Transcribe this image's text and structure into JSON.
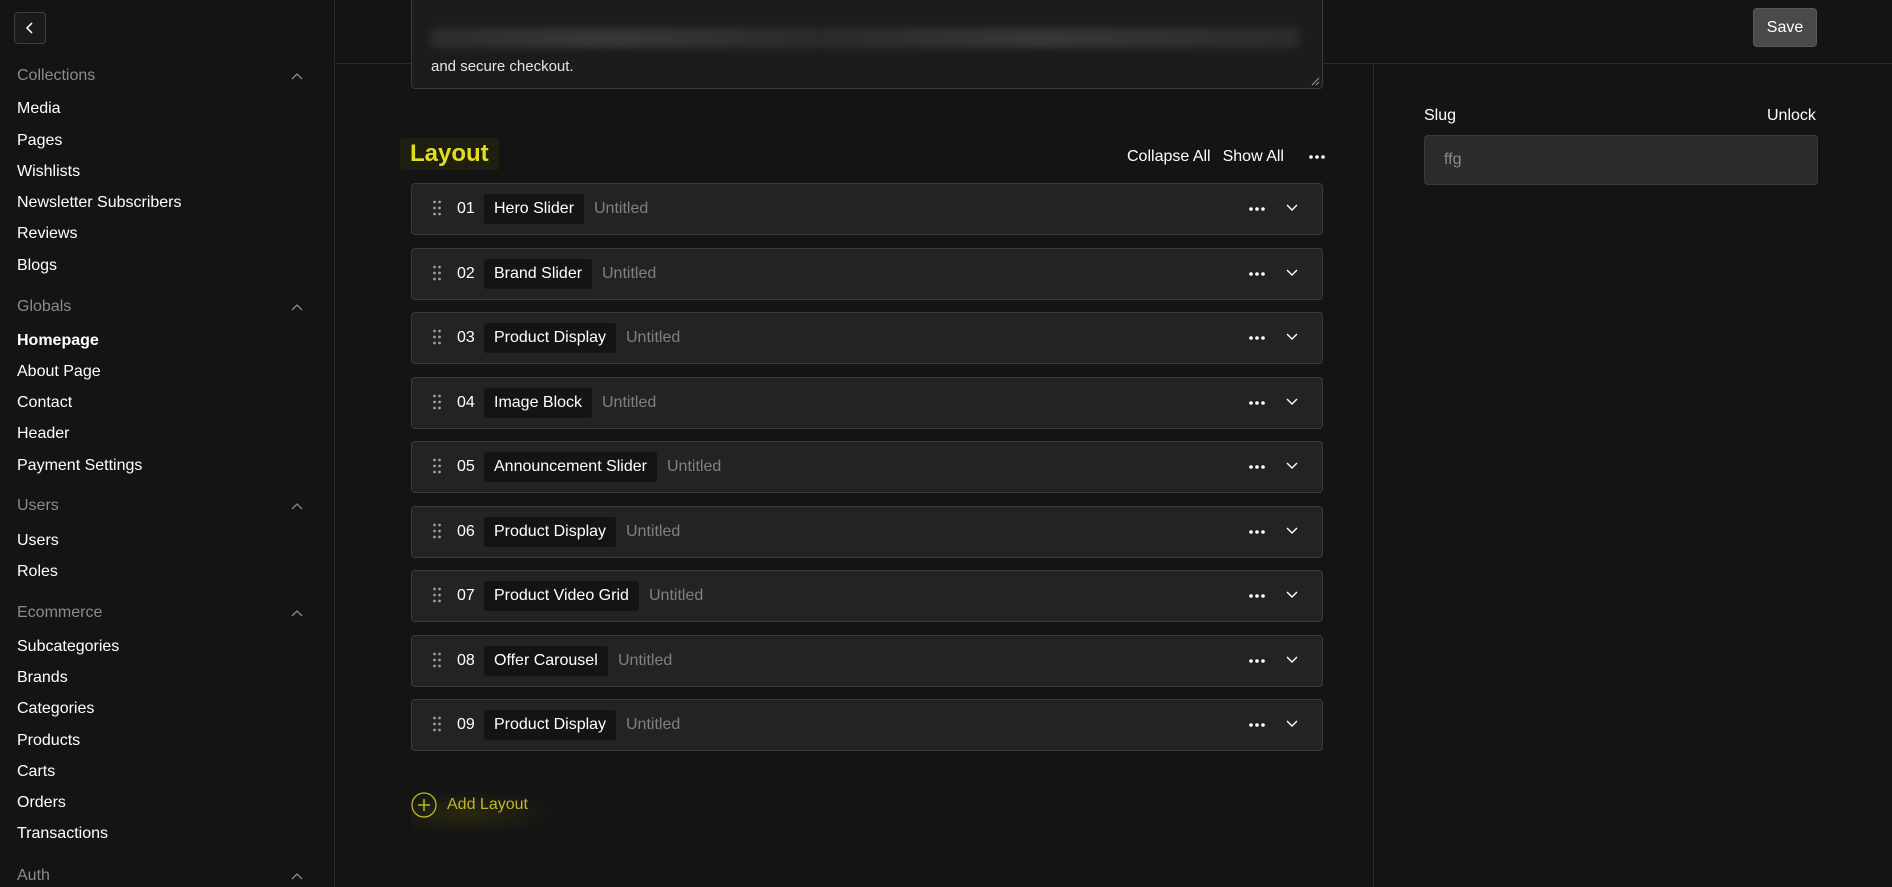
{
  "sidebar": {
    "groups": [
      {
        "title": "Collections",
        "items": [
          "Media",
          "Pages",
          "Wishlists",
          "Newsletter Subscribers",
          "Reviews",
          "Blogs"
        ]
      },
      {
        "title": "Globals",
        "items": [
          "Homepage",
          "About Page",
          "Contact",
          "Header",
          "Payment Settings"
        ],
        "active": "Homepage"
      },
      {
        "title": "Users",
        "items": [
          "Users",
          "Roles"
        ]
      },
      {
        "title": "Ecommerce",
        "items": [
          "Subcategories",
          "Brands",
          "Categories",
          "Products",
          "Carts",
          "Orders",
          "Transactions"
        ]
      },
      {
        "title": "Auth",
        "items": []
      }
    ]
  },
  "toolbar": {
    "save_label": "Save"
  },
  "description_field": {
    "visible_text": "and secure checkout."
  },
  "layout_section": {
    "title": "Layout",
    "collapse_all_label": "Collapse All",
    "show_all_label": "Show All",
    "blocks": [
      {
        "num": "01",
        "type": "Hero Slider",
        "title": "Untitled"
      },
      {
        "num": "02",
        "type": "Brand Slider",
        "title": "Untitled"
      },
      {
        "num": "03",
        "type": "Product Display",
        "title": "Untitled"
      },
      {
        "num": "04",
        "type": "Image Block",
        "title": "Untitled"
      },
      {
        "num": "05",
        "type": "Announcement Slider",
        "title": "Untitled"
      },
      {
        "num": "06",
        "type": "Product Display",
        "title": "Untitled"
      },
      {
        "num": "07",
        "type": "Product Video Grid",
        "title": "Untitled"
      },
      {
        "num": "08",
        "type": "Offer Carousel",
        "title": "Untitled"
      },
      {
        "num": "09",
        "type": "Product Display",
        "title": "Untitled"
      }
    ],
    "add_layout_label": "Add Layout"
  },
  "sidebar_panel": {
    "slug_label": "Slug",
    "unlock_label": "Unlock",
    "slug_value": "ffg"
  },
  "colors": {
    "accent": "#e3dd1f",
    "background": "#141414",
    "block_bg": "#232323"
  }
}
